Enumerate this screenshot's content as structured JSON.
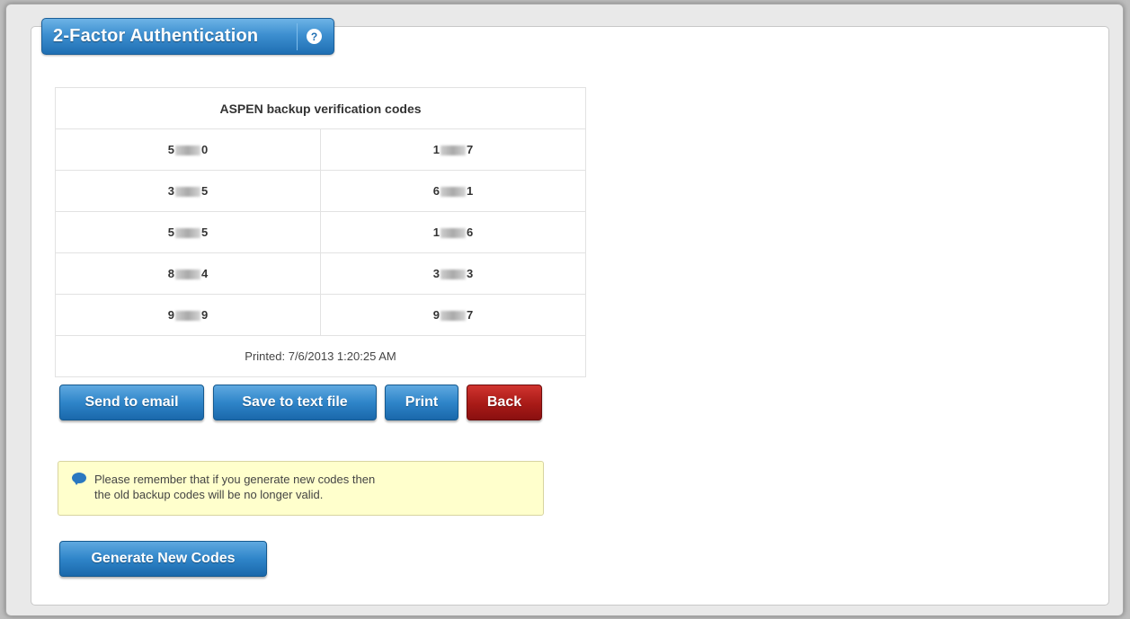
{
  "header": {
    "title": "2-Factor Authentication",
    "help_icon": "?"
  },
  "codes_table": {
    "heading": "ASPEN backup verification codes",
    "rows": [
      [
        {
          "start": "5",
          "end": "0"
        },
        {
          "start": "1",
          "end": "7"
        }
      ],
      [
        {
          "start": "3",
          "end": "5"
        },
        {
          "start": "6",
          "end": "1"
        }
      ],
      [
        {
          "start": "5",
          "end": "5"
        },
        {
          "start": "1",
          "end": "6"
        }
      ],
      [
        {
          "start": "8",
          "end": "4"
        },
        {
          "start": "3",
          "end": "3"
        }
      ],
      [
        {
          "start": "9",
          "end": "9"
        },
        {
          "start": "9",
          "end": "7"
        }
      ]
    ],
    "printed": "Printed: 7/6/2013 1:20:25 AM"
  },
  "actions": {
    "send_email": "Send to email",
    "save_text": "Save to text file",
    "print": "Print",
    "back": "Back"
  },
  "notice": {
    "icon": "chat-bubble-icon",
    "line1": "Please remember that if you generate new codes then",
    "line2": "the old backup codes will be no longer valid."
  },
  "generate_button": "Generate New Codes",
  "colors": {
    "primary_blue": "#2f85c9",
    "danger_red": "#a81a17",
    "notice_bg": "#ffffcc"
  }
}
